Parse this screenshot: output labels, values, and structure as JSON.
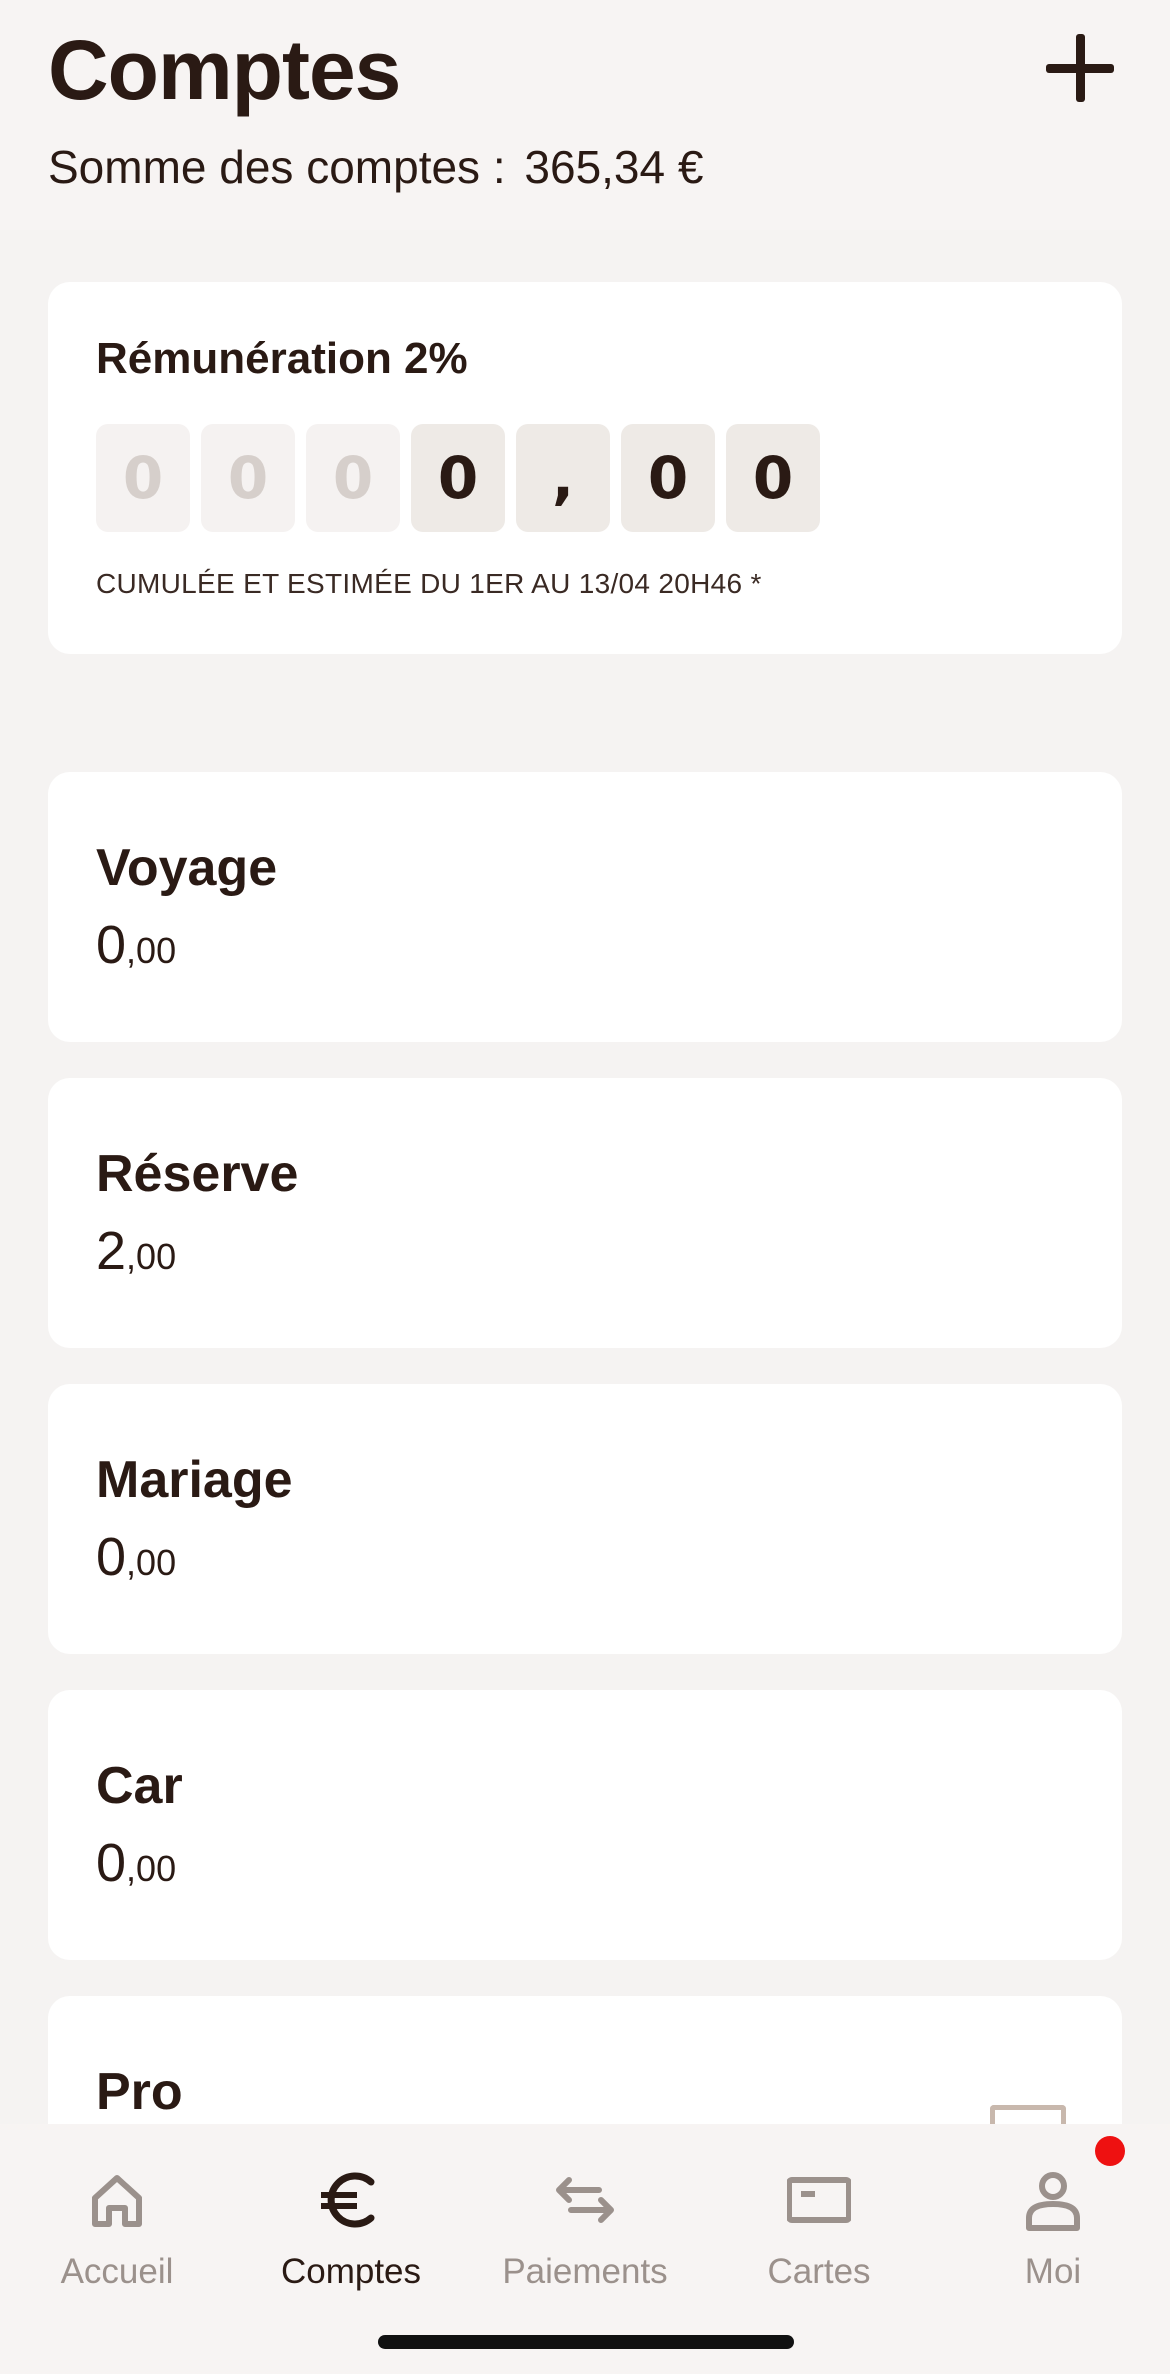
{
  "header": {
    "title": "Comptes",
    "sum_label": "Somme des comptes :",
    "sum_value": "365,34 €"
  },
  "remuneration": {
    "title": "Rémunération 2%",
    "digits": [
      "0",
      "0",
      "0",
      "0",
      ",",
      "0",
      "0"
    ],
    "note": "CUMULÉE ET ESTIMÉE DU 1ER AU 13/04 20H46 *"
  },
  "accounts": [
    {
      "name": "Voyage",
      "int": "0",
      "dec": ",00"
    },
    {
      "name": "Réserve",
      "int": "2",
      "dec": ",00"
    },
    {
      "name": "Mariage",
      "int": "0",
      "dec": ",00"
    },
    {
      "name": "Car",
      "int": "0",
      "dec": ",00"
    },
    {
      "name": "Pro",
      "int": "",
      "dec": ""
    }
  ],
  "tabs": [
    {
      "label": "Accueil",
      "icon": "home-icon"
    },
    {
      "label": "Comptes",
      "icon": "euro-icon"
    },
    {
      "label": "Paiements",
      "icon": "transfer-arrows-icon"
    },
    {
      "label": "Cartes",
      "icon": "card-icon"
    },
    {
      "label": "Moi",
      "icon": "person-icon"
    }
  ],
  "colors": {
    "text": "#2a1a14",
    "inactive_tab": "#9b918c",
    "badge": "#ee1111",
    "background": "#f5f3f2"
  }
}
